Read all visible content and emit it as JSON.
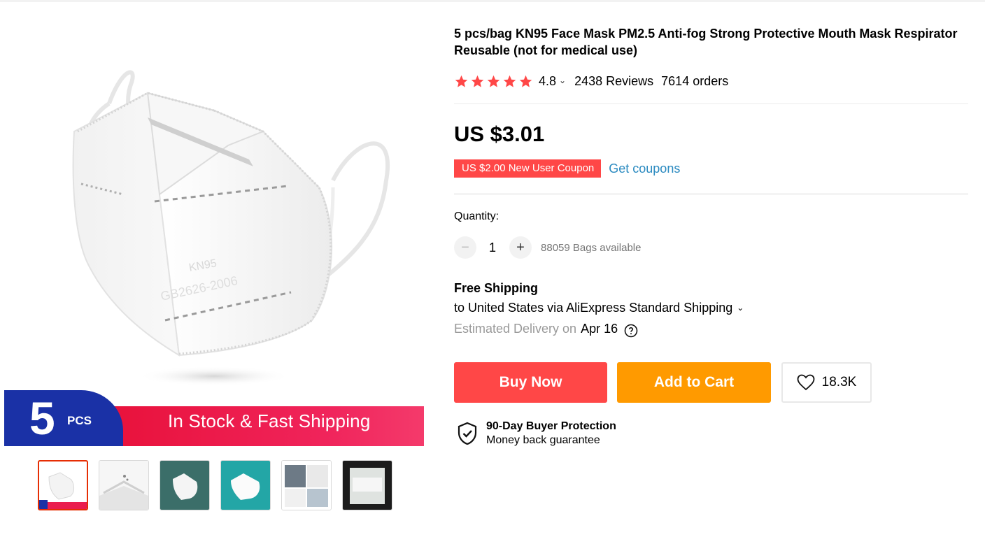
{
  "product": {
    "title": "5 pcs/bag KN95 Face Mask PM2.5 Anti-fog Strong Protective Mouth Mask Respirator Reusable (not for medical use)",
    "rating": "4.8",
    "reviews": "2438 Reviews",
    "orders": "7614 orders",
    "price": "US $3.01",
    "star_color": "#ff4747"
  },
  "coupon": {
    "tag": "US $2.00 New User Coupon",
    "link": "Get coupons"
  },
  "quantity": {
    "label": "Quantity:",
    "value": "1",
    "minus": "−",
    "plus": "+",
    "available": "88059 Bags available"
  },
  "shipping": {
    "title": "Free Shipping",
    "destination": "to United States via AliExpress Standard Shipping",
    "estimate_label": "Estimated Delivery on",
    "estimate_date": "Apr 16"
  },
  "actions": {
    "buy_now": "Buy Now",
    "add_to_cart": "Add to Cart",
    "wishlist_count": "18.3K"
  },
  "protection": {
    "title": "90-Day Buyer Protection",
    "subtitle": "Money back guarantee"
  },
  "gallery": {
    "banner_count": "5",
    "banner_unit": "PCS",
    "banner_text": "In Stock & Fast Shipping",
    "mask_print_line1": "KN95",
    "mask_print_line2": "GB2626-2006",
    "thumbnail_count": 6
  },
  "colors": {
    "accent_red": "#ff4747",
    "accent_orange": "#ff9a00",
    "link_blue": "#2a8ac0",
    "banner_blue": "#1a31a6",
    "banner_red": "#e8113a"
  }
}
